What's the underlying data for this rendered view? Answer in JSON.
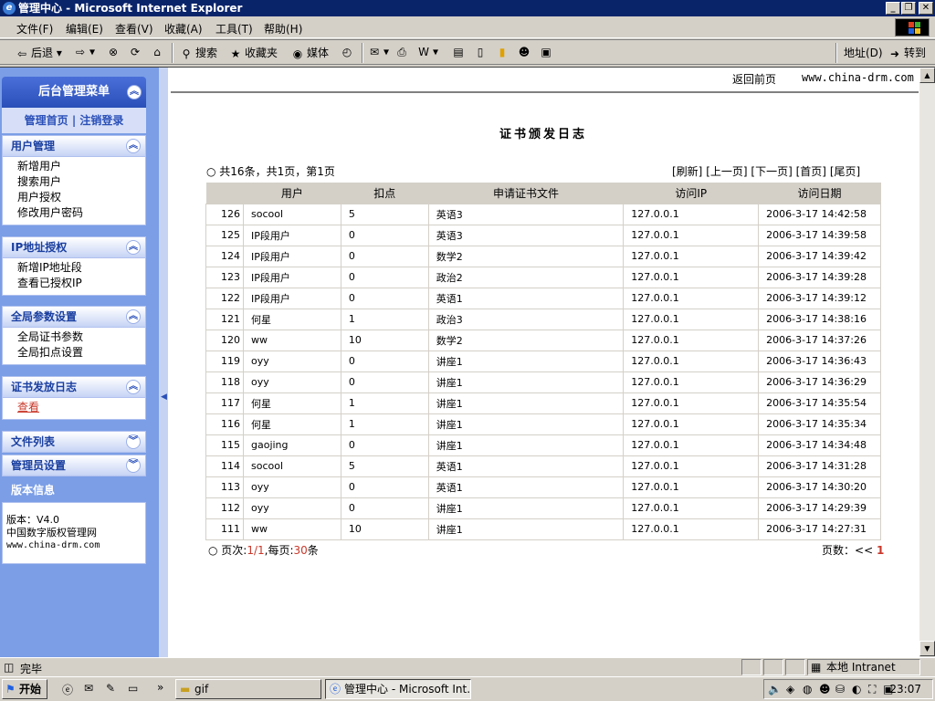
{
  "window": {
    "title": "管理中心 - Microsoft Internet Explorer"
  },
  "menubar": [
    "文件(F)",
    "编辑(E)",
    "查看(V)",
    "收藏(A)",
    "工具(T)",
    "帮助(H)"
  ],
  "toolbar": {
    "back": "后退",
    "search": "搜索",
    "favorites": "收藏夹",
    "media": "媒体",
    "address": "地址(D)",
    "go": "转到"
  },
  "sidebar": {
    "header": "后台管理菜单",
    "links": [
      "管理首页",
      "注销登录"
    ],
    "panels": [
      {
        "title": "用户管理",
        "items": [
          "新增用户",
          "搜索用户",
          "用户授权",
          "修改用户密码"
        ]
      },
      {
        "title": "IP地址授权",
        "items": [
          "新增IP地址段",
          "查看已授权IP"
        ]
      },
      {
        "title": "全局参数设置",
        "items": [
          "全局证书参数",
          "全局扣点设置"
        ]
      },
      {
        "title": "证书发放日志",
        "items": [
          "查看"
        ]
      }
    ],
    "collapsed": [
      "文件列表",
      "管理员设置"
    ],
    "info_title": "版本信息",
    "info_lines": [
      "版本：V4.0",
      "中国数字版权管理网",
      "www.china-drm.com"
    ]
  },
  "main": {
    "home_link": "返回前页",
    "site": "www.china-drm.com",
    "title": "证书颁发日志",
    "summary": "共16条，共1页，第1页",
    "nav": [
      "[刷新]",
      "[上一页]",
      "[下一页]",
      "[首页]",
      "[尾页]"
    ],
    "columns": [
      "",
      "用户",
      "扣点",
      "申请证书文件",
      "访问IP",
      "访问日期"
    ],
    "rows": [
      [
        "126",
        "socool",
        "5",
        "英语3",
        "127.0.0.1",
        "2006-3-17 14:42:58"
      ],
      [
        "125",
        "IP段用户",
        "0",
        "英语3",
        "127.0.0.1",
        "2006-3-17 14:39:58"
      ],
      [
        "124",
        "IP段用户",
        "0",
        "数学2",
        "127.0.0.1",
        "2006-3-17 14:39:42"
      ],
      [
        "123",
        "IP段用户",
        "0",
        "政治2",
        "127.0.0.1",
        "2006-3-17 14:39:28"
      ],
      [
        "122",
        "IP段用户",
        "0",
        "英语1",
        "127.0.0.1",
        "2006-3-17 14:39:12"
      ],
      [
        "121",
        "何星",
        "1",
        "政治3",
        "127.0.0.1",
        "2006-3-17 14:38:16"
      ],
      [
        "120",
        "ww",
        "10",
        "数学2",
        "127.0.0.1",
        "2006-3-17 14:37:26"
      ],
      [
        "119",
        "oyy",
        "0",
        "讲座1",
        "127.0.0.1",
        "2006-3-17 14:36:43"
      ],
      [
        "118",
        "oyy",
        "0",
        "讲座1",
        "127.0.0.1",
        "2006-3-17 14:36:29"
      ],
      [
        "117",
        "何星",
        "1",
        "讲座1",
        "127.0.0.1",
        "2006-3-17 14:35:54"
      ],
      [
        "116",
        "何星",
        "1",
        "讲座1",
        "127.0.0.1",
        "2006-3-17 14:35:34"
      ],
      [
        "115",
        "gaojing",
        "0",
        "讲座1",
        "127.0.0.1",
        "2006-3-17 14:34:48"
      ],
      [
        "114",
        "socool",
        "5",
        "英语1",
        "127.0.0.1",
        "2006-3-17 14:31:28"
      ],
      [
        "113",
        "oyy",
        "0",
        "英语1",
        "127.0.0.1",
        "2006-3-17 14:30:20"
      ],
      [
        "112",
        "oyy",
        "0",
        "讲座1",
        "127.0.0.1",
        "2006-3-17 14:29:39"
      ],
      [
        "111",
        "ww",
        "10",
        "讲座1",
        "127.0.0.1",
        "2006-3-17 14:27:31"
      ]
    ],
    "footer": {
      "page_label": "页次:",
      "page_value": "1/1",
      "per_page_label": ",每页:",
      "per_page_value": "30",
      "per_page_unit": "条"
    },
    "pager": {
      "label": "页数：",
      "first": "<<",
      "current": "1"
    }
  },
  "statusbar": {
    "text": "完毕",
    "zone": "本地 Intranet"
  },
  "taskbar": {
    "start": "开始",
    "tasks": [
      "gif",
      "管理中心 - Microsoft Int..."
    ],
    "clock": "23:07"
  }
}
